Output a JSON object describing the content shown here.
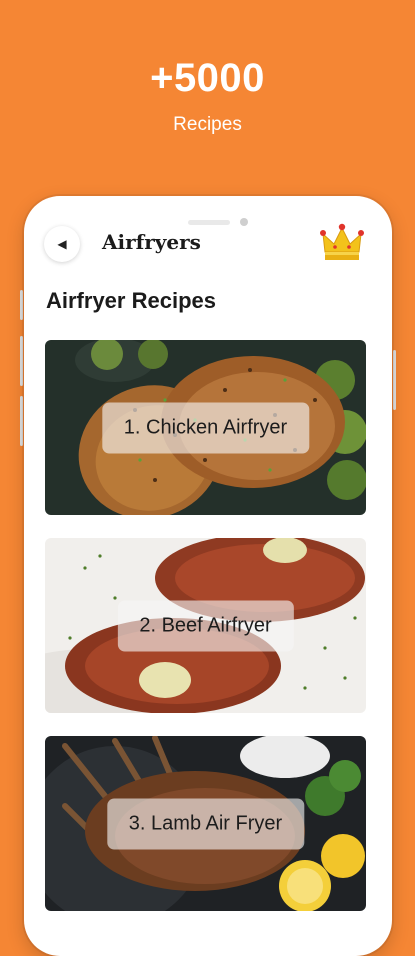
{
  "promo": {
    "title": "+5000",
    "subtitle": "Recipes"
  },
  "header": {
    "back_icon": "back-arrow-icon",
    "app_title": "Airfryers",
    "premium_icon": "crown-icon"
  },
  "section": {
    "heading": "Airfryer Recipes"
  },
  "recipes": [
    {
      "label": "1. Chicken Airfryer",
      "image": "grilled chicken breasts with brussels sprouts"
    },
    {
      "label": "2. Beef Airfryer",
      "image": "ribeye steaks with herb butter"
    },
    {
      "label": "3. Lamb Air Fryer",
      "image": "lamb chops with lemon and dip"
    }
  ],
  "colors": {
    "background": "#F58634",
    "crown": "#F3C21B",
    "crown_jewels": "#E0342B"
  }
}
